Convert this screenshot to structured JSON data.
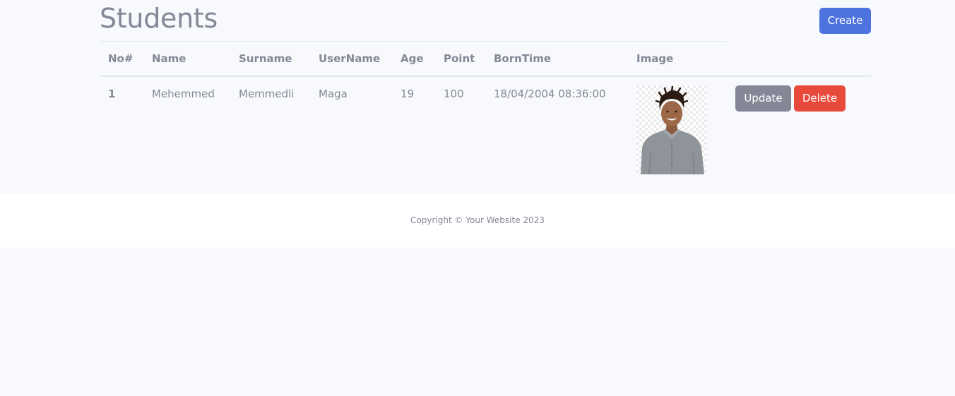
{
  "page": {
    "title": "Students",
    "create_label": "Create"
  },
  "table": {
    "headers": [
      "No#",
      "Name",
      "Surname",
      "UserName",
      "Age",
      "Point",
      "BornTime",
      "Image"
    ],
    "rows": [
      {
        "no": "1",
        "name": "Mehemmed",
        "surname": "Memmedli",
        "username": "Maga",
        "age": "19",
        "point": "100",
        "borntime": "18/04/2004 08:36:00",
        "update_label": "Update",
        "delete_label": "Delete"
      }
    ]
  },
  "footer": {
    "copyright": "Copyright © Your Website 2023"
  },
  "colors": {
    "primary": "#4e73df",
    "secondary": "#858796",
    "danger": "#e74a3b",
    "background": "#f8f9fc"
  }
}
